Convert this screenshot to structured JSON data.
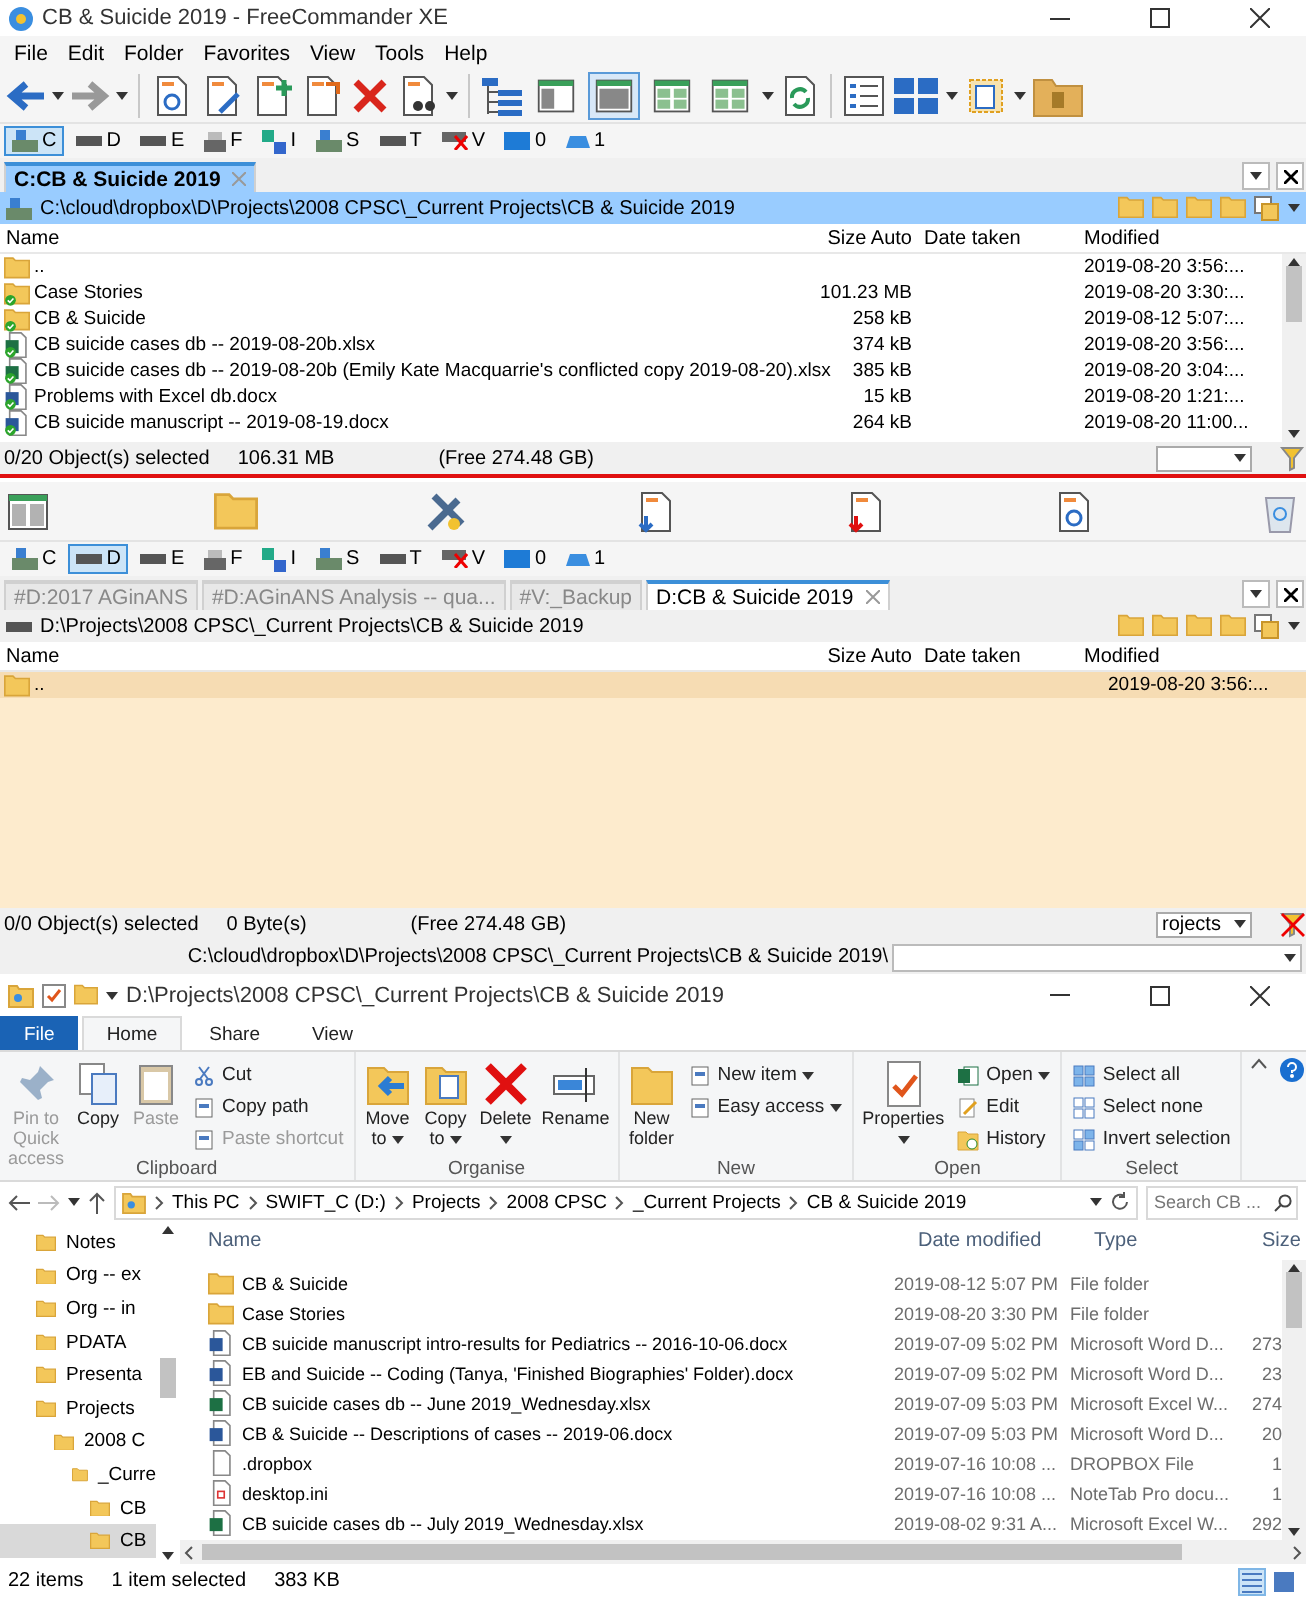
{
  "freecommander": {
    "title": "CB & Suicide 2019 - FreeCommander XE",
    "menu": [
      "File",
      "Edit",
      "Folder",
      "Favorites",
      "View",
      "Tools",
      "Help"
    ],
    "view_modes": [
      {
        "selected": false
      },
      {
        "selected": true
      },
      {
        "selected": false
      },
      {
        "selected": false
      }
    ],
    "panels": [
      {
        "active": true,
        "drives": [
          {
            "label": "C",
            "kind": "network",
            "selected": true
          },
          {
            "label": "D",
            "kind": "drive",
            "selected": false
          },
          {
            "label": "E",
            "kind": "drive",
            "selected": false
          },
          {
            "label": "F",
            "kind": "printer",
            "selected": false
          },
          {
            "label": "I",
            "kind": "sync",
            "selected": false
          },
          {
            "label": "S",
            "kind": "network",
            "selected": false
          },
          {
            "label": "T",
            "kind": "drive",
            "selected": false
          },
          {
            "label": "V",
            "kind": "offline",
            "selected": false
          },
          {
            "label": "0",
            "kind": "monitor",
            "selected": false
          },
          {
            "label": "1",
            "kind": "cloud",
            "selected": false
          }
        ],
        "tabs": [
          {
            "label": "C:CB & Suicide 2019",
            "selected": true
          }
        ],
        "path": "C:\\cloud\\dropbox\\D\\Projects\\2008 CPSC\\_Current Projects\\CB & Suicide 2019",
        "columns": [
          "Name",
          "Size Auto",
          "Date taken",
          "Modified"
        ],
        "rows": [
          {
            "kind": "up",
            "synced": false,
            "name": "..",
            "modified": "2019-08-20 3:56:..."
          },
          {
            "kind": "folder",
            "synced": true,
            "name": "Case Stories",
            "size": "101.23 MB",
            "modified": "2019-08-20 3:30:..."
          },
          {
            "kind": "folder",
            "synced": true,
            "name": "CB & Suicide",
            "size": "258 kB",
            "modified": "2019-08-12 5:07:..."
          },
          {
            "kind": "xlsx",
            "synced": true,
            "name": "CB suicide cases db -- 2019-08-20b.xlsx",
            "size": "374 kB",
            "modified": "2019-08-20 3:56:..."
          },
          {
            "kind": "xlsx",
            "synced": true,
            "name": "CB suicide cases db -- 2019-08-20b (Emily Kate Macquarrie's conflicted copy 2019-08-20).xlsx",
            "size": "385 kB",
            "modified": "2019-08-20 3:04:..."
          },
          {
            "kind": "docx",
            "synced": true,
            "name": "Problems with Excel db.docx",
            "size": "15 kB",
            "modified": "2019-08-20 1:21:..."
          },
          {
            "kind": "docx",
            "synced": true,
            "name": "CB suicide manuscript -- 2019-08-19.docx",
            "size": "264 kB",
            "modified": "2019-08-20 11:00..."
          }
        ],
        "status": {
          "selection": "0/20 Object(s) selected",
          "size": "106.31 MB",
          "free": "(Free 274.48 GB)"
        }
      },
      {
        "active": false,
        "drives": [
          {
            "label": "C",
            "kind": "network",
            "selected": false
          },
          {
            "label": "D",
            "kind": "drive",
            "selected": true
          },
          {
            "label": "E",
            "kind": "drive",
            "selected": false
          },
          {
            "label": "F",
            "kind": "printer",
            "selected": false
          },
          {
            "label": "I",
            "kind": "sync",
            "selected": false
          },
          {
            "label": "S",
            "kind": "network",
            "selected": false
          },
          {
            "label": "T",
            "kind": "drive",
            "selected": false
          },
          {
            "label": "V",
            "kind": "offline",
            "selected": false
          },
          {
            "label": "0",
            "kind": "monitor",
            "selected": false
          },
          {
            "label": "1",
            "kind": "cloud",
            "selected": false
          }
        ],
        "tabs": [
          {
            "label": "#D:2017 AGinANS",
            "selected": false
          },
          {
            "label": "#D:AGinANS Analysis -- qua...",
            "selected": false
          },
          {
            "label": "#V:_Backup",
            "selected": false
          },
          {
            "label": "D:CB & Suicide 2019",
            "selected": true
          }
        ],
        "path": "D:\\Projects\\2008 CPSC\\_Current Projects\\CB & Suicide 2019",
        "columns": [
          "Name",
          "Size Auto",
          "Date taken",
          "Modified"
        ],
        "rows": [
          {
            "kind": "up",
            "synced": false,
            "name": "..",
            "modified": "2019-08-20 3:56:..."
          }
        ],
        "status": {
          "selection": "0/0 Object(s) selected",
          "size": "0 Byte(s)",
          "free": "(Free 274.48 GB)"
        },
        "filter": "rojects"
      }
    ],
    "command_path": "C:\\cloud\\dropbox\\D\\Projects\\2008 CPSC\\_Current Projects\\CB & Suicide 2019\\"
  },
  "explorer": {
    "title": "D:\\Projects\\2008 CPSC\\_Current Projects\\CB & Suicide 2019",
    "ribbon_tabs": [
      {
        "label": "File",
        "kind": "file",
        "selected": false
      },
      {
        "label": "Home",
        "kind": "tab",
        "selected": true
      },
      {
        "label": "Share",
        "kind": "tab",
        "selected": false
      },
      {
        "label": "View",
        "kind": "tab",
        "selected": false
      }
    ],
    "ribbon_groups": [
      {
        "label": "Clipboard",
        "commands": [
          {
            "label": "Pin to Quick access",
            "kind": "large",
            "disabled": true,
            "dropdown": false
          },
          {
            "label": "Copy",
            "kind": "large",
            "disabled": false,
            "dropdown": false
          },
          {
            "label": "Paste",
            "kind": "large",
            "disabled": true,
            "dropdown": false
          },
          {
            "label": "Cut",
            "kind": "small",
            "disabled": false,
            "dropdown": false
          },
          {
            "label": "Copy path",
            "kind": "small",
            "disabled": false,
            "dropdown": false
          },
          {
            "label": "Paste shortcut",
            "kind": "small",
            "disabled": true,
            "dropdown": false
          }
        ]
      },
      {
        "label": "Organise",
        "commands": [
          {
            "label": "Move to",
            "kind": "large",
            "disabled": false,
            "dropdown": true
          },
          {
            "label": "Copy to",
            "kind": "large",
            "disabled": false,
            "dropdown": true
          },
          {
            "label": "Delete",
            "kind": "large",
            "disabled": false,
            "dropdown": true
          },
          {
            "label": "Rename",
            "kind": "large",
            "disabled": false,
            "dropdown": false
          }
        ]
      },
      {
        "label": "New",
        "commands": [
          {
            "label": "New folder",
            "kind": "large",
            "disabled": false,
            "dropdown": false
          },
          {
            "label": "New item",
            "kind": "small",
            "disabled": false,
            "dropdown": true
          },
          {
            "label": "Easy access",
            "kind": "small",
            "disabled": false,
            "dropdown": true
          }
        ]
      },
      {
        "label": "Open",
        "commands": [
          {
            "label": "Properties",
            "kind": "large",
            "disabled": false,
            "dropdown": true
          },
          {
            "label": "Open",
            "kind": "small",
            "disabled": false,
            "dropdown": true
          },
          {
            "label": "Edit",
            "kind": "small",
            "disabled": false,
            "dropdown": false
          },
          {
            "label": "History",
            "kind": "small",
            "disabled": false,
            "dropdown": false
          }
        ]
      },
      {
        "label": "Select",
        "commands": [
          {
            "label": "Select all",
            "kind": "small",
            "disabled": false,
            "dropdown": false
          },
          {
            "label": "Select none",
            "kind": "small",
            "disabled": false,
            "dropdown": false
          },
          {
            "label": "Invert selection",
            "kind": "small",
            "disabled": false,
            "dropdown": false
          }
        ]
      }
    ],
    "breadcrumb": [
      "This PC",
      "SWIFT_C (D:)",
      "Projects",
      "2008 CPSC",
      "_Current Projects",
      "CB & Suicide 2019"
    ],
    "search": {
      "placeholder": "Search CB ..."
    },
    "nav_tree": [
      {
        "label": "Notes",
        "selected": false
      },
      {
        "label": "Org -- ex",
        "selected": false
      },
      {
        "label": "Org -- in",
        "selected": false
      },
      {
        "label": "PDATA",
        "selected": false
      },
      {
        "label": "Presenta",
        "selected": false
      },
      {
        "label": "Projects",
        "selected": false,
        "children": [
          {
            "label": "2008 C",
            "selected": false,
            "children": [
              {
                "label": "_Curre",
                "selected": false,
                "children": [
                  {
                    "label": "CB",
                    "selected": false
                  },
                  {
                    "label": "CB",
                    "selected": true
                  }
                ]
              }
            ]
          }
        ]
      }
    ],
    "columns": [
      "Name",
      "Date modified",
      "Type",
      "Size"
    ],
    "rows": [
      {
        "kind": "folder",
        "name": "CB & Suicide",
        "date": "2019-08-12 5:07 PM",
        "type": "File folder"
      },
      {
        "kind": "folder",
        "name": "Case Stories",
        "date": "2019-08-20 3:30 PM",
        "type": "File folder"
      },
      {
        "kind": "docx",
        "name": "CB suicide manuscript intro-results for Pediatrics -- 2016-10-06.docx",
        "date": "2019-07-09 5:02 PM",
        "type": "Microsoft Word D...",
        "size": "273"
      },
      {
        "kind": "docx",
        "name": "EB and Suicide -- Coding (Tanya, 'Finished Biographies' Folder).docx",
        "date": "2019-07-09 5:02 PM",
        "type": "Microsoft Word D...",
        "size": "23"
      },
      {
        "kind": "xlsx",
        "name": "CB suicide cases db -- June 2019_Wednesday.xlsx",
        "date": "2019-07-09 5:03 PM",
        "type": "Microsoft Excel W...",
        "size": "274"
      },
      {
        "kind": "docx",
        "name": "CB & Suicide -- Descriptions of cases -- 2019-06.docx",
        "date": "2019-07-09 5:03 PM",
        "type": "Microsoft Word D...",
        "size": "20"
      },
      {
        "kind": "file",
        "name": ".dropbox",
        "date": "2019-07-16 10:08 ...",
        "type": "DROPBOX File",
        "size": "1"
      },
      {
        "kind": "ini",
        "name": "desktop.ini",
        "date": "2019-07-16 10:08 ...",
        "type": "NoteTab Pro docu...",
        "size": "1"
      },
      {
        "kind": "xlsx",
        "name": "CB suicide cases db -- July 2019_Wednesday.xlsx",
        "date": "2019-08-02 9:31 A...",
        "type": "Microsoft Excel W...",
        "size": "292"
      }
    ],
    "status": {
      "count": "22 items",
      "selection": "1 item selected",
      "selection_size": "383 KB"
    }
  }
}
